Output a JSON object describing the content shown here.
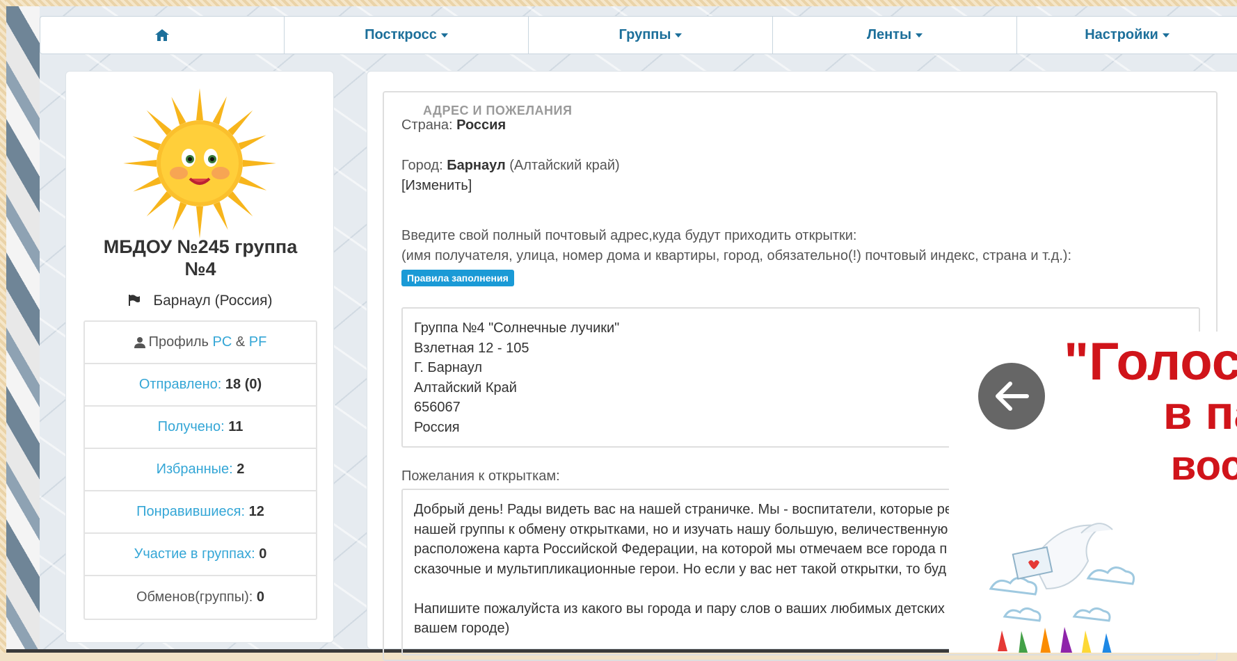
{
  "nav": {
    "home_icon": "home-icon",
    "items": [
      {
        "label": "Посткросс"
      },
      {
        "label": "Группы"
      },
      {
        "label": "Ленты"
      },
      {
        "label": "Настройки"
      }
    ]
  },
  "profile": {
    "avatar": "sun-avatar",
    "name_line1": "МБДОУ №245 группа",
    "name_line2": "№4",
    "location": "Барнаул (Россия)",
    "profile_label": "Профиль",
    "profile_pc": "PC",
    "profile_amp": "&",
    "profile_pf": "PF",
    "stats": {
      "sent_label": "Отправлено:",
      "sent_value": "18",
      "sent_extra": "(0)",
      "received_label": "Получено:",
      "received_value": "11",
      "favorites_label": "Избранные:",
      "favorites_value": "2",
      "liked_label": "Понравившиеся:",
      "liked_value": "12",
      "groups_label": "Участие в группах:",
      "groups_value": "0",
      "exchanges_label": "Обменов(группы):",
      "exchanges_value": "0"
    }
  },
  "address": {
    "legend": "АДРЕС И ПОЖЕЛАНИЯ",
    "country_label": "Страна:",
    "country_value": "Россия",
    "city_label": "Город:",
    "city_value": "Барнаул",
    "city_region": "(Алтайский край)",
    "change_link": "[Изменить]",
    "instruction1": "Введите свой полный почтовый адрес,куда будут приходить открытки:",
    "instruction2": "(имя получателя, улица, номер дома и квартиры, город, обязательно(!) почтовый индекс, страна и т.д.):",
    "rules_button": "Правила заполнения",
    "lines": [
      "Группа №4 \"Солнечные лучики\"",
      "Взлетная 12 - 105",
      "Г. Барнаул",
      "Алтайский Край",
      "656067",
      "Россия"
    ],
    "wishes_label": "Пожелания к открыткам:",
    "wishes_lines": [
      "Добрый день! Рады видеть вас на нашей страничке. Мы - воспитатели, которые ре",
      "нашей группы к обмену открытками, но и изучать нашу большую, величественную",
      "расположена карта Российской Федерации, на которой мы отмечаем все города п",
      "сказочные и мультипликационные герои. Но если у вас нет такой открытки, то буд",
      "",
      "Напишите пожалуйста из какого вы города и пару слов о ваших любимых детских",
      "вашем городе)"
    ]
  },
  "overlay": {
    "title_line1": "\"Голос",
    "title_line2": "в патри",
    "title_line3": "восп",
    "back_icon": "arrow-left-icon",
    "accent": "#d0141a"
  }
}
